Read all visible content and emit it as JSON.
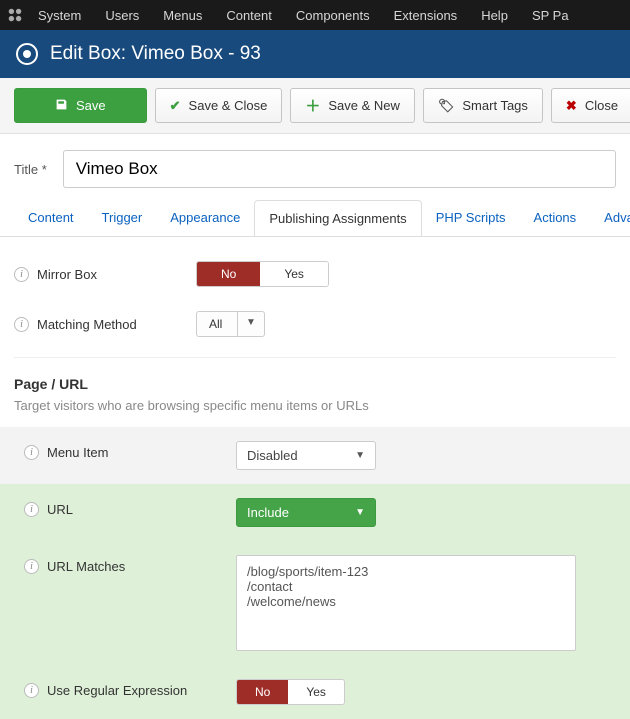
{
  "sysbar": {
    "items": [
      "System",
      "Users",
      "Menus",
      "Content",
      "Components",
      "Extensions",
      "Help",
      "SP Pa"
    ]
  },
  "header": {
    "title": "Edit Box: Vimeo Box - 93"
  },
  "toolbar": {
    "save": "Save",
    "saveclose": "Save & Close",
    "savenew": "Save & New",
    "smarttags": "Smart Tags",
    "close": "Close"
  },
  "titlefield": {
    "label": "Title *",
    "value": "Vimeo Box"
  },
  "tabs": [
    "Content",
    "Trigger",
    "Appearance",
    "Publishing Assignments",
    "PHP Scripts",
    "Actions",
    "Adva"
  ],
  "activeTabIndex": 3,
  "mirror": {
    "label": "Mirror Box",
    "no": "No",
    "yes": "Yes"
  },
  "matching": {
    "label": "Matching Method",
    "value": "All"
  },
  "pageurl": {
    "title": "Page / URL",
    "desc": "Target visitors who are browsing specific menu items or URLs"
  },
  "menuitem": {
    "label": "Menu Item",
    "value": "Disabled"
  },
  "url": {
    "label": "URL",
    "value": "Include"
  },
  "urlmatches": {
    "label": "URL Matches",
    "value": "/blog/sports/item-123\n/contact\n/welcome/news"
  },
  "regex": {
    "label": "Use Regular Expression",
    "no": "No",
    "yes": "Yes"
  }
}
